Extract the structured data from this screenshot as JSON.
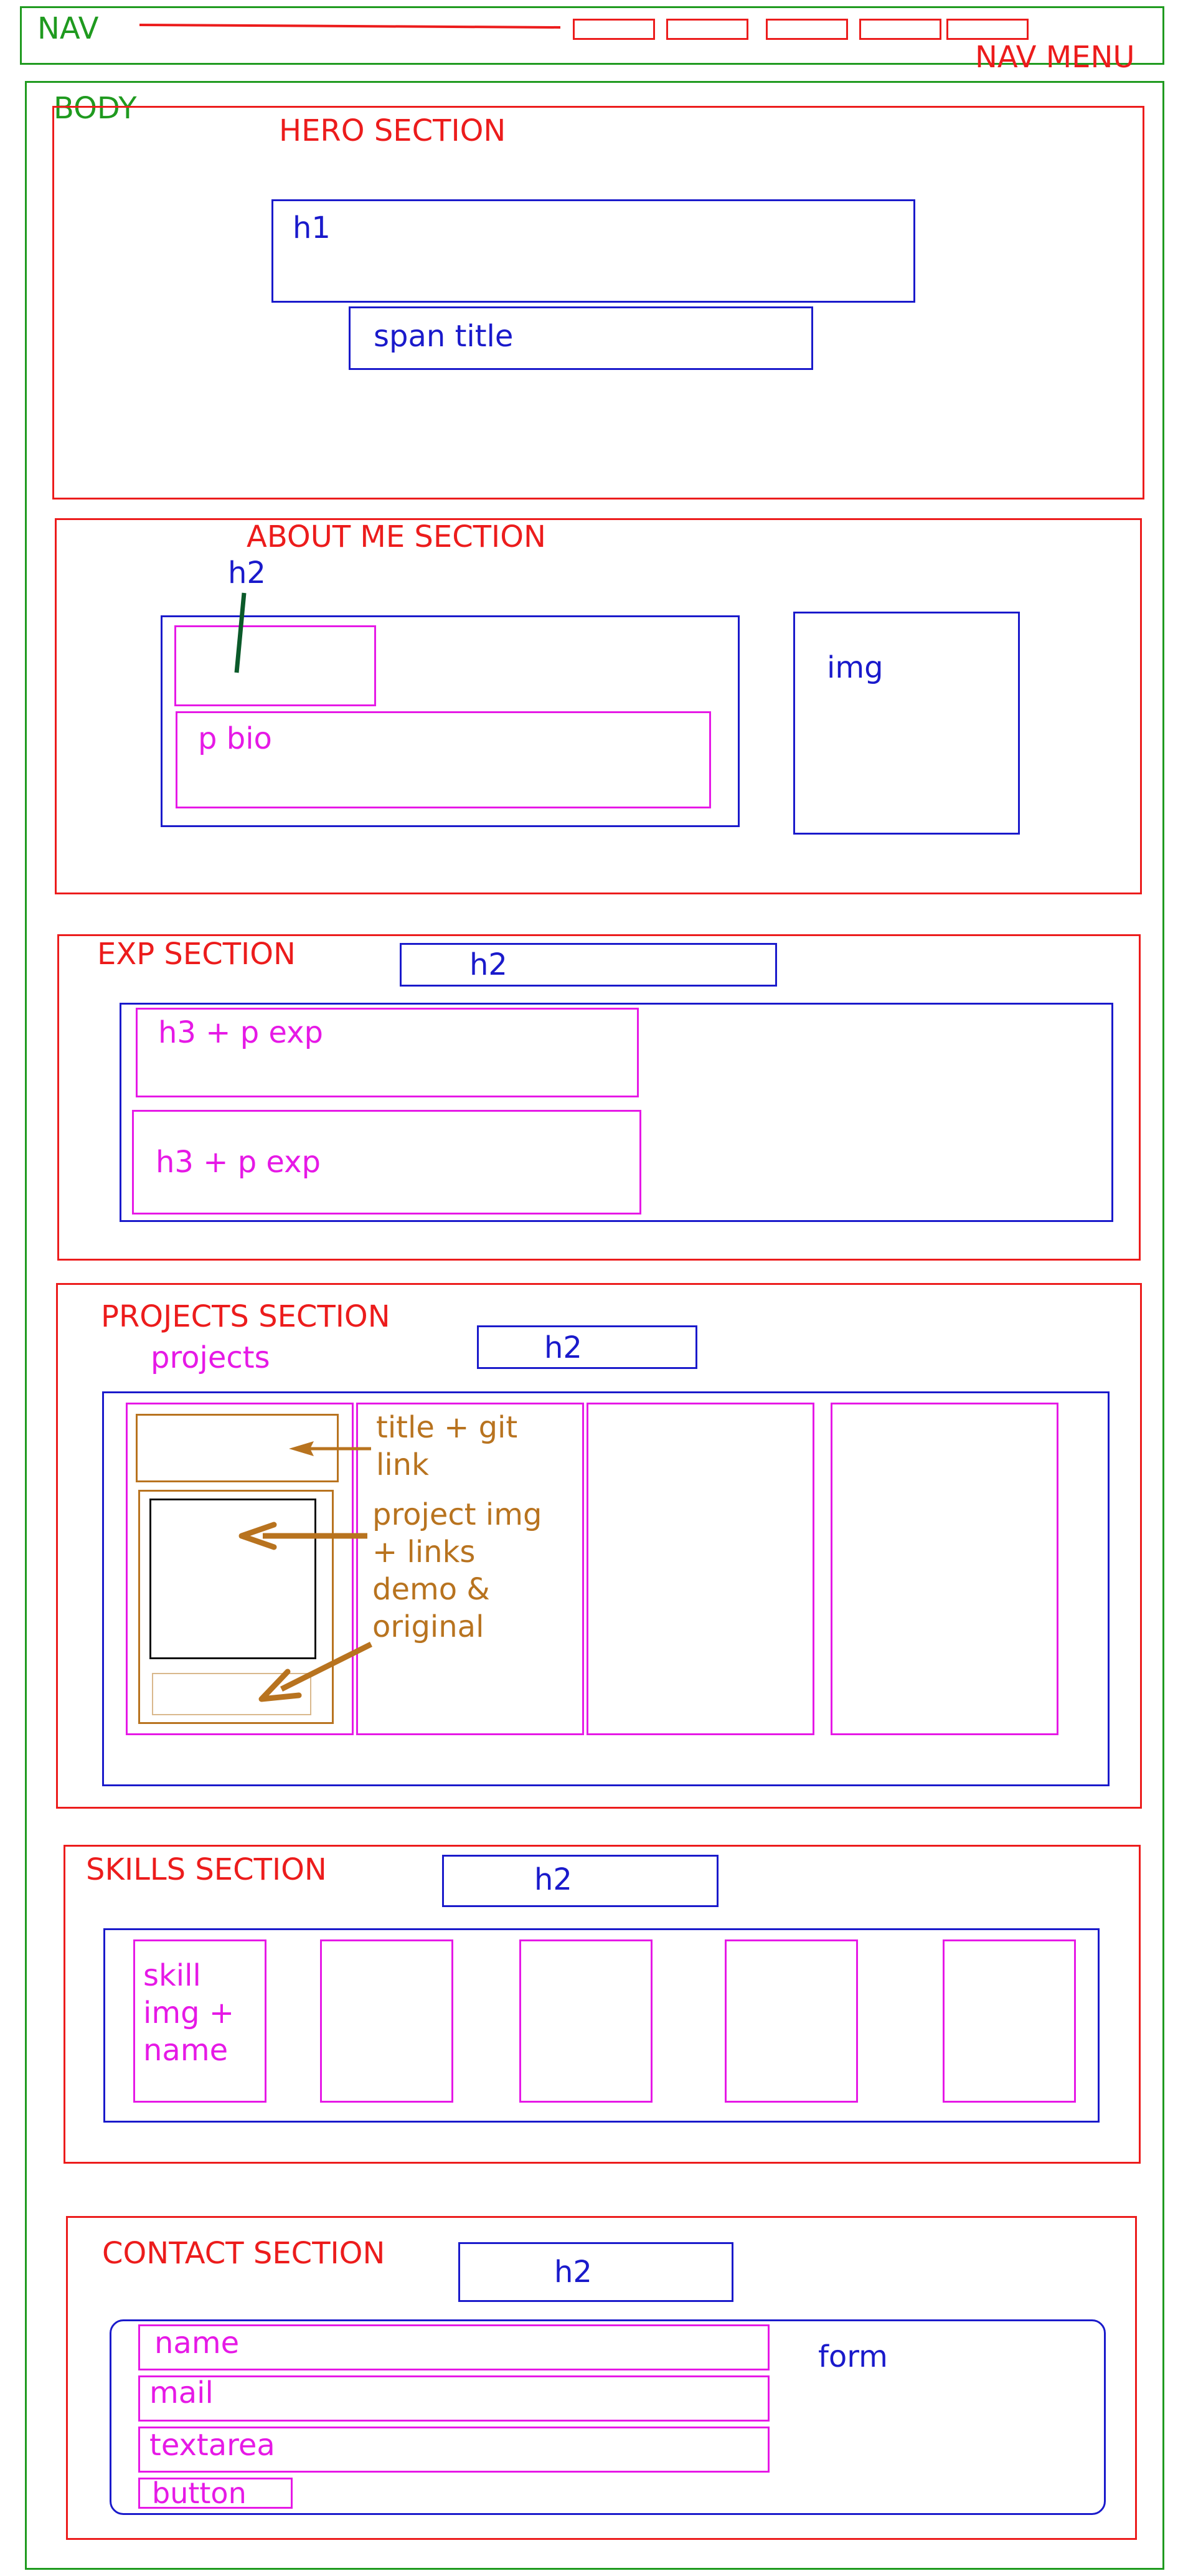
{
  "nav": {
    "label": "NAV",
    "menu_label": "NAV MENU"
  },
  "body": {
    "label": "BODY"
  },
  "hero": {
    "label": "HERO SECTION",
    "h1": "h1",
    "span": "span title"
  },
  "about": {
    "label": "ABOUT ME SECTION",
    "h2": "h2",
    "bio": "p bio",
    "img": "img"
  },
  "exp": {
    "label": "EXP SECTION",
    "h2": "h2",
    "items": [
      "h3 + p exp",
      "h3 + p exp"
    ]
  },
  "projects": {
    "label": "PROJECTS SECTION",
    "sub_label": "projects",
    "h2": "h2",
    "note_title": "title + git\nlink",
    "note_img": "project img\n+ links\ndemo &\noriginal"
  },
  "skills": {
    "label": "SKILLS SECTION",
    "h2": "h2",
    "card": "skill\nimg +\nname"
  },
  "contact": {
    "label": "CONTACT SECTION",
    "h2": "h2",
    "form": "form",
    "fields": [
      "name",
      "mail",
      "textarea"
    ],
    "button": "button"
  },
  "colors": {
    "layout": "#1f9a1f",
    "section": "#ec1c1c",
    "block": "#1a1acb",
    "item": "#e619e6",
    "annotation": "#b8731f",
    "pointer": "#0b5a2a"
  }
}
